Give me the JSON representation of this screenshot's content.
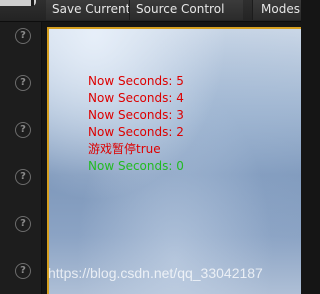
{
  "toolbar": {
    "save_current": "Save Current",
    "source_control": "Source Control",
    "modes": "Modes"
  },
  "sidebar": {
    "help_icon_glyph": "?",
    "item_count": 6
  },
  "log": {
    "lines": [
      {
        "text": "Now Seconds: 5",
        "color": "#dd0000"
      },
      {
        "text": "Now Seconds: 4",
        "color": "#dd0000"
      },
      {
        "text": "Now Seconds: 3",
        "color": "#dd0000"
      },
      {
        "text": "Now Seconds: 2",
        "color": "#dd0000"
      },
      {
        "text": "游戏暂停true",
        "color": "#dd0000"
      },
      {
        "text": "Now Seconds: 0",
        "color": "#22bb22"
      }
    ]
  },
  "watermark": "https://blog.csdn.net/qq_33042187",
  "colors": {
    "accent_border": "#d6a020",
    "toolbar_bg": "#2b2b2b",
    "sidebar_bg": "#1d1d1d"
  }
}
